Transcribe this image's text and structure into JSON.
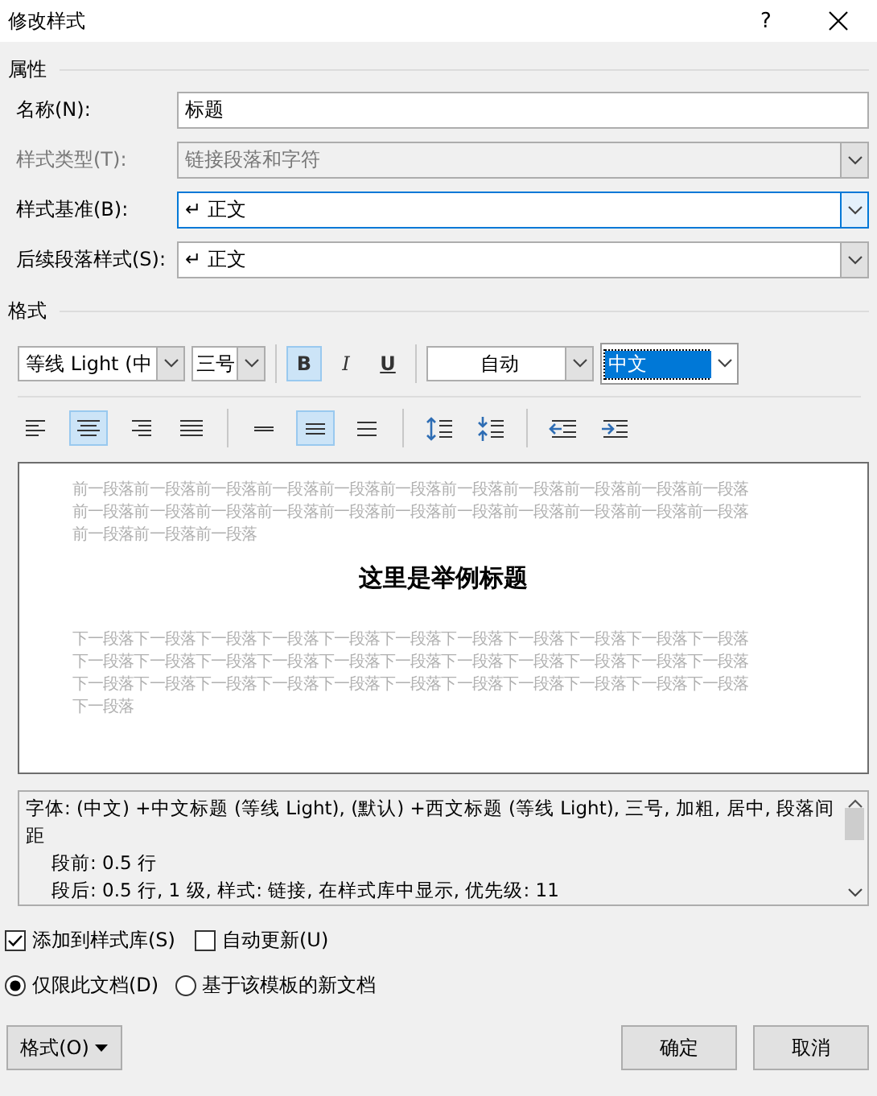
{
  "window": {
    "title": "修改样式",
    "help": "?"
  },
  "properties": {
    "heading": "属性",
    "rows": [
      {
        "label": "名称(N):",
        "value": "标题",
        "kind": "text",
        "disabled": false,
        "focused": false
      },
      {
        "label": "样式类型(T):",
        "value": "链接段落和字符",
        "kind": "combo",
        "disabled": true,
        "focused": false
      },
      {
        "label": "样式基准(B):",
        "value": "↵ 正文",
        "kind": "combo",
        "disabled": false,
        "focused": true
      },
      {
        "label": "后续段落样式(S):",
        "value": "↵ 正文",
        "kind": "combo",
        "disabled": false,
        "focused": false
      }
    ]
  },
  "format": {
    "heading": "格式",
    "font": "等线 Light (中",
    "size": "三号",
    "styles": [
      {
        "kind": "bold",
        "label": "B",
        "selected": true
      },
      {
        "kind": "italic",
        "label": "I",
        "selected": false
      },
      {
        "kind": "underline",
        "label": "U",
        "selected": false
      }
    ],
    "shade_setting": "自动",
    "script": "中文",
    "paragraph_groups": [
      [
        {
          "kind": "align-left",
          "selected": false
        },
        {
          "kind": "align-center",
          "selected": true
        },
        {
          "kind": "align-right",
          "selected": false
        },
        {
          "kind": "justify",
          "selected": false
        }
      ],
      [
        {
          "kind": "single",
          "selected": false
        },
        {
          "kind": "one-half",
          "selected": true
        },
        {
          "kind": "double",
          "selected": false
        }
      ],
      [
        {
          "kind": "space-increase",
          "selected": false
        },
        {
          "kind": "space-decrease",
          "selected": false
        }
      ],
      [
        {
          "kind": "indent-decrease",
          "selected": false
        },
        {
          "kind": "indent-increase",
          "selected": false
        }
      ]
    ]
  },
  "preview": {
    "before": [
      "前一段落前一段落前一段落前一段落前一段落前一段落前一段落前一段落前一段落前一段落前一段落",
      "前一段落前一段落前一段落前一段落前一段落前一段落前一段落前一段落前一段落前一段落前一段落",
      "前一段落前一段落前一段落"
    ],
    "sample": "这里是举例标题",
    "after": [
      "下一段落下一段落下一段落下一段落下一段落下一段落下一段落下一段落下一段落下一段落下一段落",
      "下一段落下一段落下一段落下一段落下一段落下一段落下一段落下一段落下一段落下一段落下一段落",
      "下一段落下一段落下一段落下一段落下一段落下一段落下一段落下一段落下一段落下一段落下一段落",
      "下一段落"
    ]
  },
  "description": [
    "字体: (中文) +中文标题 (等线 Light), (默认) +西文标题 (等线 Light), 三号, 加粗, 居中, 段落间距",
    "段前: 0.5 行",
    "段后: 0.5 行, 1 级, 样式: 链接, 在样式库中显示, 优先级: 11"
  ],
  "checkboxes": [
    {
      "label": "添加到样式库(S)",
      "checked": true
    },
    {
      "label": "自动更新(U)",
      "checked": false
    }
  ],
  "radios": [
    {
      "label": "仅限此文档(D)",
      "selected": true
    },
    {
      "label": "基于该模板的新文档",
      "selected": false
    }
  ],
  "buttons": {
    "format": "格式(O)",
    "ok": "确定",
    "cancel": "取消"
  }
}
